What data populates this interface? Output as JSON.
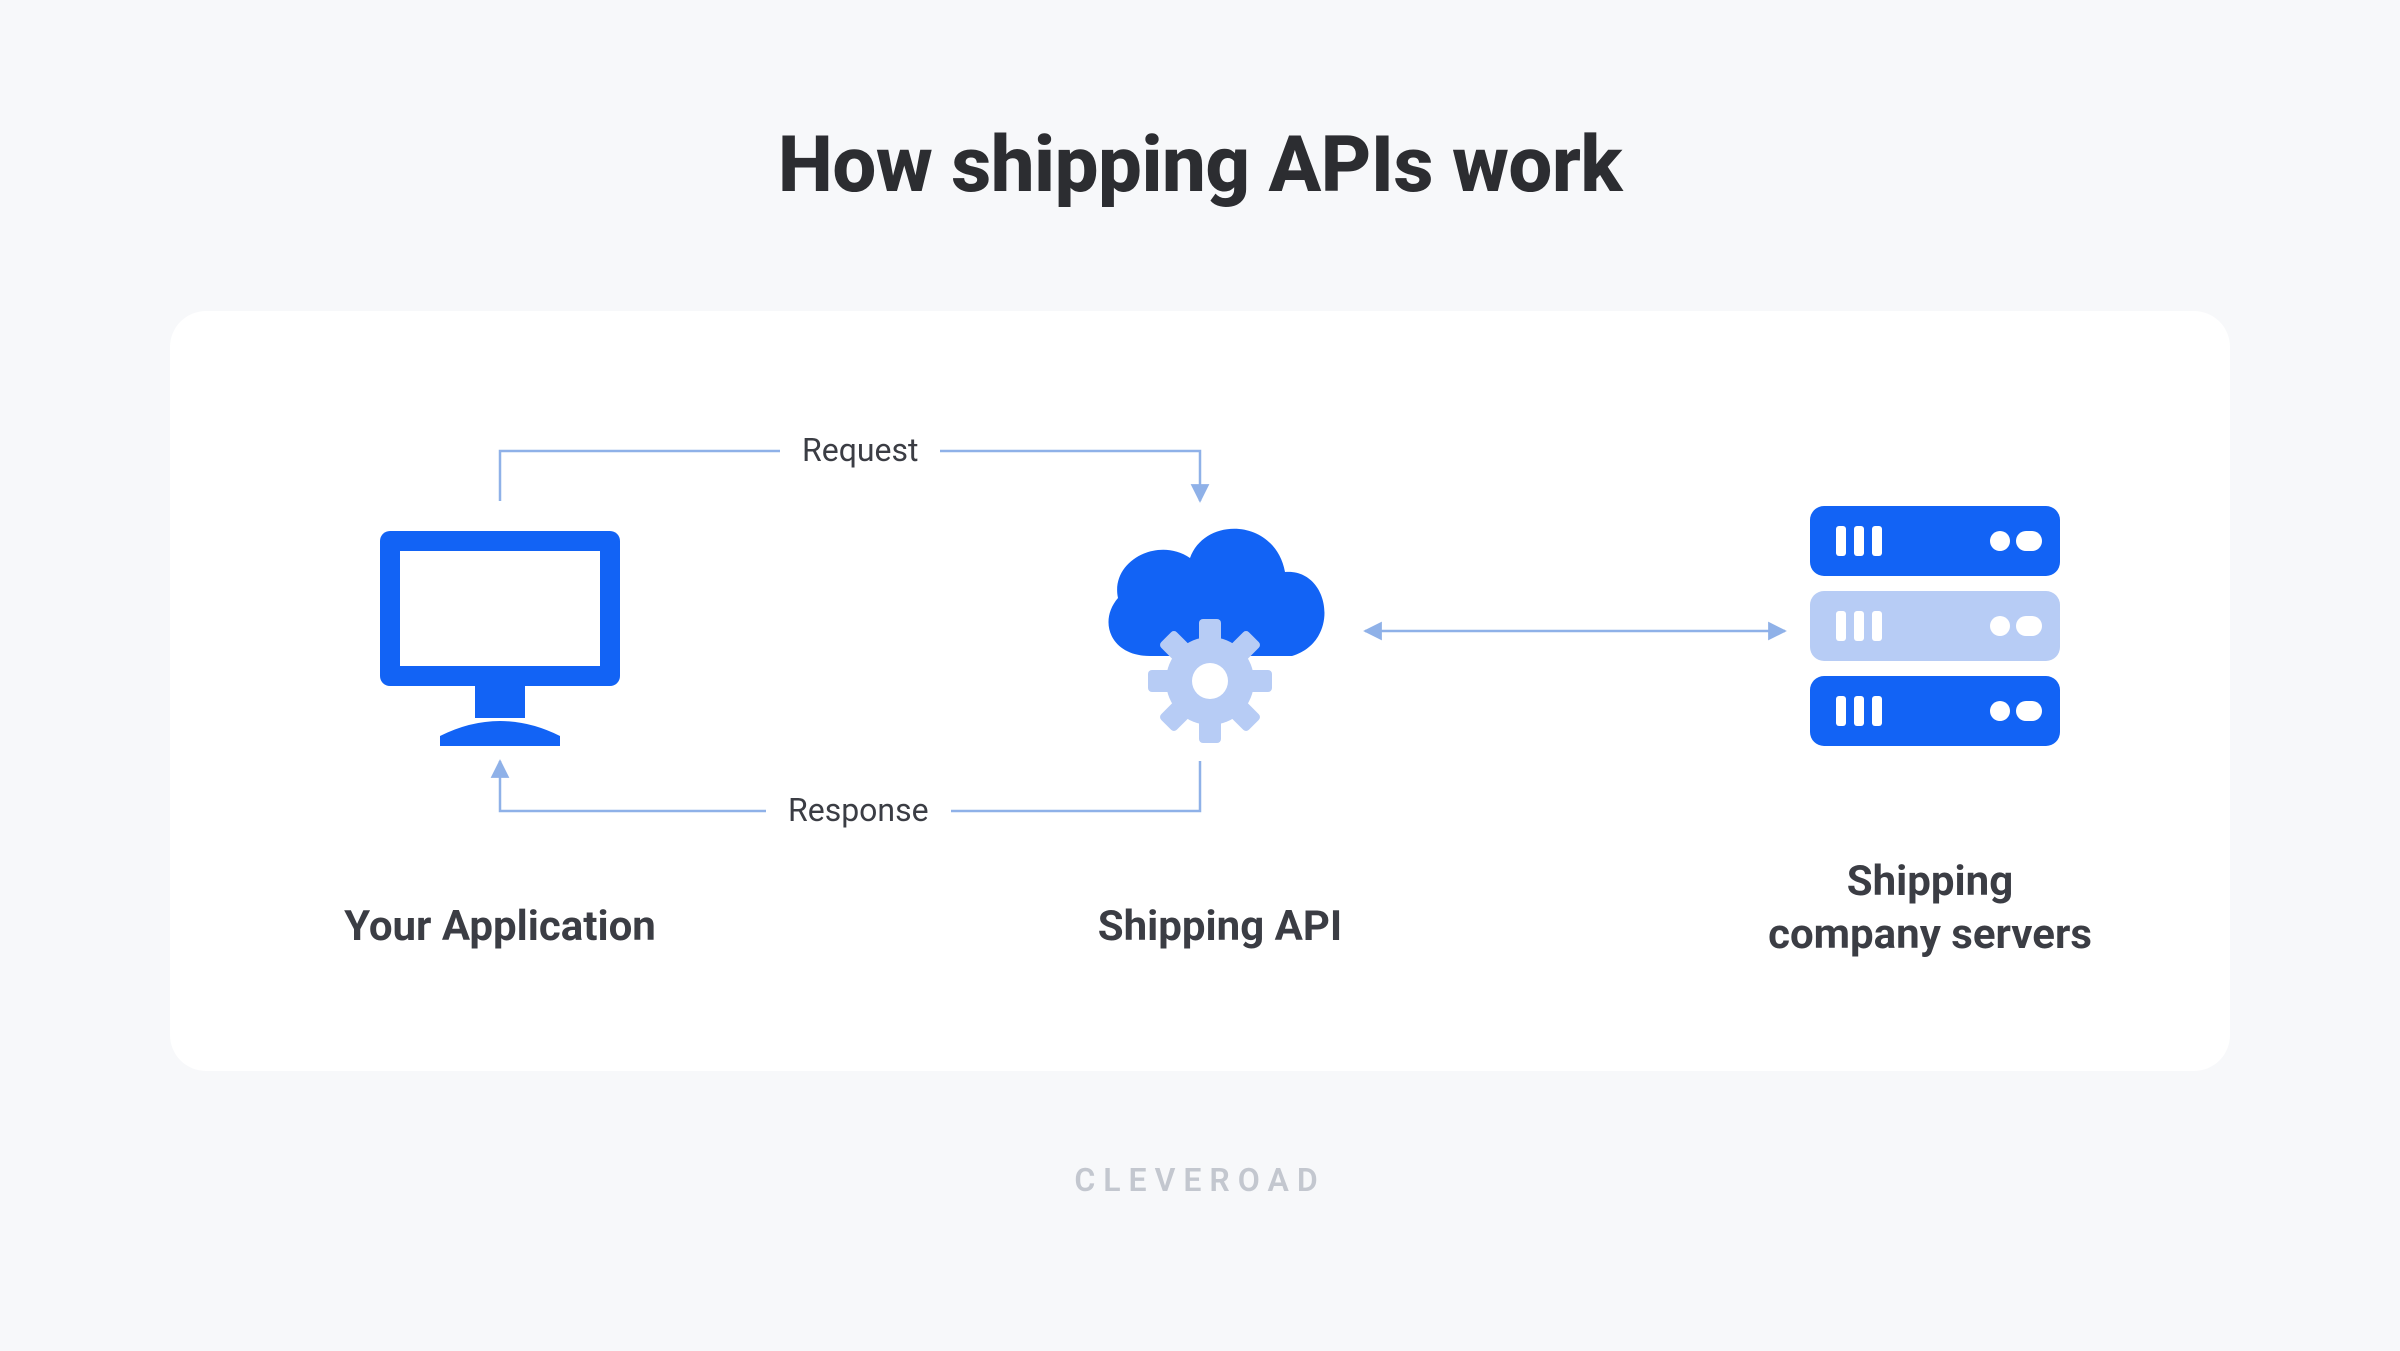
{
  "title": "How shipping APIs work",
  "brand": "CLEVEROAD",
  "nodes": {
    "app": "Your Application",
    "api": "Shipping API",
    "servers": "Shipping\ncompany servers"
  },
  "flows": {
    "request": "Request",
    "response": "Response"
  },
  "colors": {
    "primary": "#1a6dff",
    "primary_alt": "#1263f5",
    "light": "#b7ccf5",
    "arrow": "#8fb1e8",
    "text": "#3b3d44"
  }
}
